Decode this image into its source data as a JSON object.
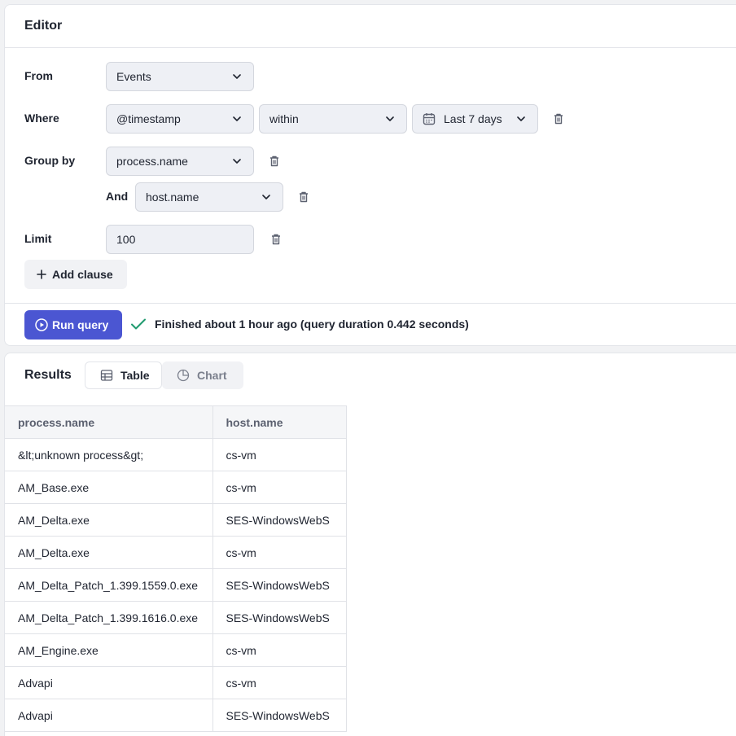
{
  "editor": {
    "title": "Editor",
    "from": {
      "label": "From",
      "value": "Events"
    },
    "where": {
      "label": "Where",
      "field": "@timestamp",
      "operator": "within",
      "range": "Last 7 days"
    },
    "group_by": {
      "label": "Group by",
      "value": "process.name",
      "and_label": "And",
      "and_value": "host.name"
    },
    "limit": {
      "label": "Limit",
      "value": "100"
    },
    "add_clause_label": "Add clause",
    "run_label": "Run query",
    "status_text": "Finished about 1 hour ago (query duration 0.442 seconds)"
  },
  "results": {
    "title": "Results",
    "tabs": [
      {
        "label": "Table",
        "icon": "table-icon",
        "active": true
      },
      {
        "label": "Chart",
        "icon": "pie-chart-icon",
        "active": false
      }
    ],
    "columns": [
      "process.name",
      "host.name"
    ],
    "rows": [
      [
        "&lt;unknown process&gt;",
        "cs-vm"
      ],
      [
        "AM_Base.exe",
        "cs-vm"
      ],
      [
        "AM_Delta.exe",
        "SES-WindowsWebS"
      ],
      [
        "AM_Delta.exe",
        "cs-vm"
      ],
      [
        "AM_Delta_Patch_1.399.1559.0.exe",
        "SES-WindowsWebS"
      ],
      [
        "AM_Delta_Patch_1.399.1616.0.exe",
        "SES-WindowsWebS"
      ],
      [
        "AM_Engine.exe",
        "cs-vm"
      ],
      [
        "Advapi",
        "cs-vm"
      ],
      [
        "Advapi",
        "SES-WindowsWebS"
      ]
    ]
  },
  "colors": {
    "accent": "#4b56d2",
    "success": "#1f9a6e",
    "border": "#e3e5ea",
    "input_bg": "#eef0f5"
  }
}
